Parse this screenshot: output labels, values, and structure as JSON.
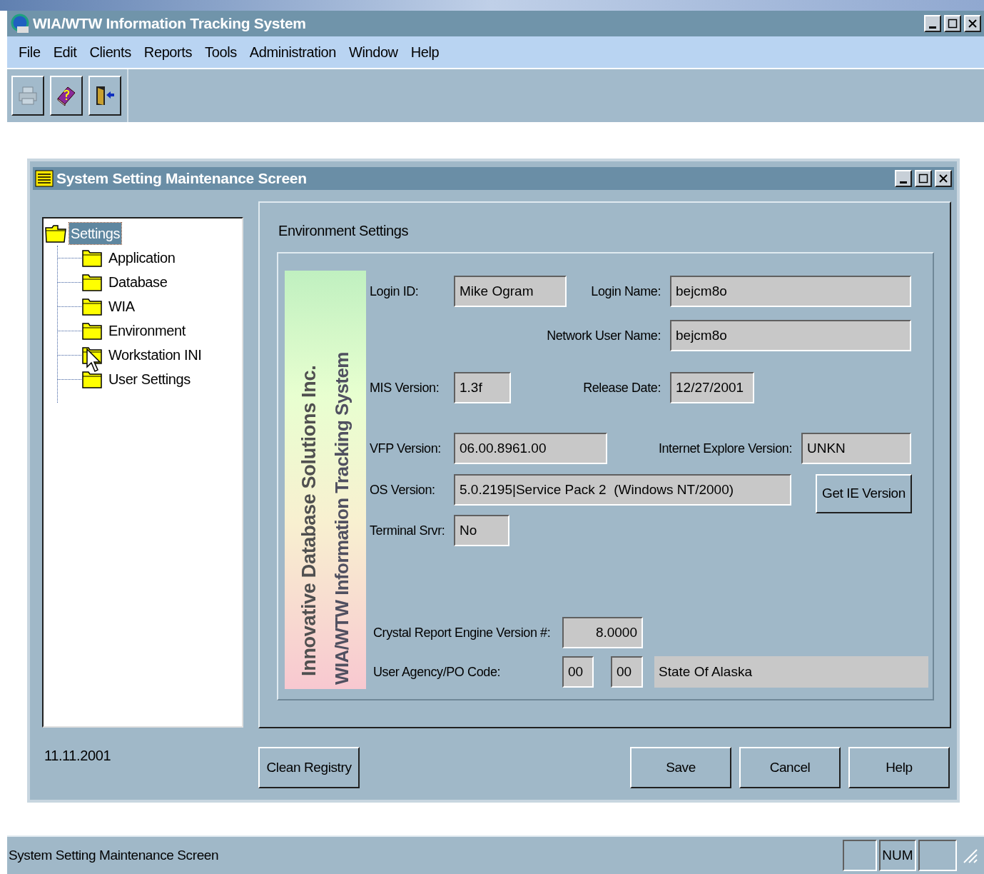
{
  "window": {
    "title": "WIA/WTW Information Tracking System"
  },
  "menu": [
    "File",
    "Edit",
    "Clients",
    "Reports",
    "Tools",
    "Administration",
    "Window",
    "Help"
  ],
  "toolbar": [
    {
      "kind": "printer",
      "disabled": true
    },
    {
      "kind": "help",
      "disabled": false
    },
    {
      "kind": "exit",
      "disabled": false
    }
  ],
  "child_window": {
    "title": "System Setting Maintenance Screen"
  },
  "tree": {
    "label": "Settings",
    "selected": true,
    "children": [
      {
        "label": "Application",
        "selected": false
      },
      {
        "label": "Database",
        "selected": false
      },
      {
        "label": "WIA",
        "selected": false
      },
      {
        "label": "Environment",
        "selected": false
      },
      {
        "label": "Workstation INI",
        "selected": false
      },
      {
        "label": "User Settings",
        "selected": false
      }
    ]
  },
  "date": "11.11.2001",
  "group": {
    "title": "Environment Settings"
  },
  "logo": {
    "line_1": "Innovative Database Solutions Inc.",
    "line_2": "WIA/WTW Information Tracking System"
  },
  "fields": {
    "login_id": {
      "label": "Login ID:",
      "value": "Mike Ogram"
    },
    "login_name": {
      "label": "Login Name:",
      "value": "bejcm8o"
    },
    "network_user_name": {
      "label": "Network User Name:",
      "value": "bejcm8o"
    },
    "mis_version": {
      "label": "MIS Version:",
      "value": "1.3f"
    },
    "release_date": {
      "label": "Release Date:",
      "value": "12/27/2001"
    },
    "vfp_version": {
      "label": "VFP Version:",
      "value": "06.00.8961.00"
    },
    "ie_version": {
      "label": "Internet Explore Version:",
      "value": "UNKN"
    },
    "os_version": {
      "label": "OS Version:",
      "value": "5.0.2195|Service Pack 2  (Windows NT/2000)"
    },
    "terminal_srvr": {
      "label": "Terminal Srvr:",
      "value": "No"
    },
    "crystal_version": {
      "label": "Crystal Report Engine Version #:",
      "value": "8.0000"
    },
    "agency": {
      "label": "User Agency/PO Code:",
      "value_1": "00",
      "value_2": "00",
      "name": "State Of Alaska"
    }
  },
  "get_ie_button": "Get IE Version",
  "clean_button": "Clean Registry",
  "buttons": [
    "Save",
    "Cancel",
    "Help"
  ],
  "status_bar": {
    "text": "System Setting Maintenance Screen",
    "num": "NUM"
  }
}
